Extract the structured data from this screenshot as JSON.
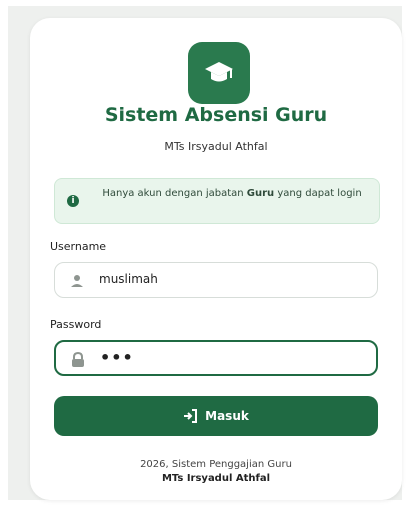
{
  "app": {
    "title": "Sistem Absensi Guru",
    "subtitle": "MTs Irsyadul Athfal"
  },
  "alert": {
    "prefix": "Hanya akun dengan jabatan ",
    "highlight": "Guru",
    "suffix": " yang dapat login",
    "icon": "info-icon"
  },
  "form": {
    "username_label": "Username",
    "username_value": "muslimah",
    "password_label": "Password",
    "password_value": "•••",
    "submit_label": "Masuk"
  },
  "footer": {
    "line1": "2026, Sistem Penggajian Guru",
    "line2": "MTs Irsyadul Athfal"
  },
  "colors": {
    "brand": "#1f6a43",
    "alert_bg": "#e9f5ec"
  }
}
